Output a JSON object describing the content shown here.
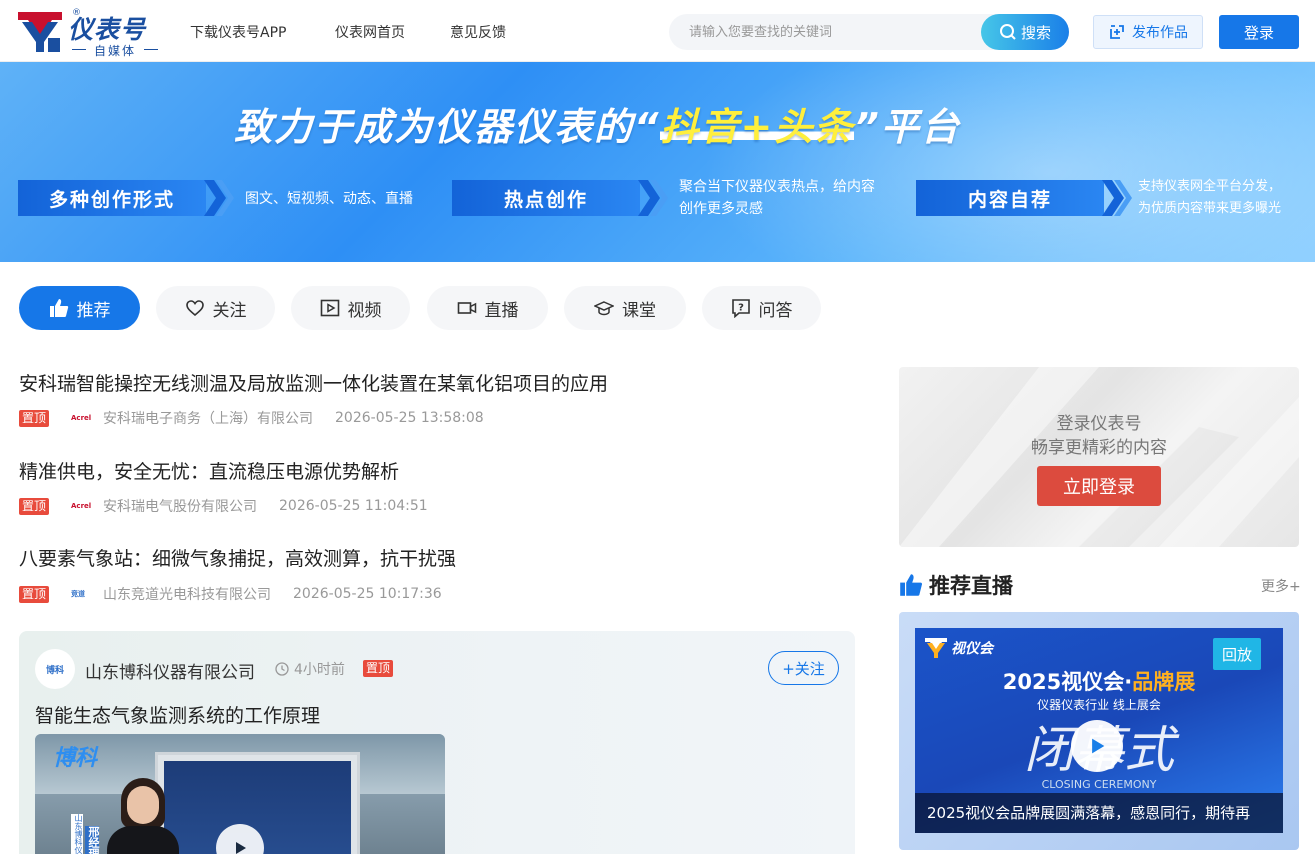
{
  "header": {
    "logo_title": "仪表号",
    "logo_sub": "自媒体",
    "logo_reg": "®",
    "nav": [
      "下载仪表号APP",
      "仪表网首页",
      "意见反馈"
    ],
    "search_placeholder": "请输入您要查找的关键词",
    "search_label": "搜索",
    "publish_label": "发布作品",
    "login_label": "登录"
  },
  "banner": {
    "title_pre": "致力于成为仪器仪表的“",
    "title_hl": "抖音+头条",
    "title_post": "”平台",
    "chips": [
      {
        "label": "多种创作形式",
        "desc": "图文、短视频、动态、直播"
      },
      {
        "label": "热点创作",
        "desc_1": "聚合当下仪器仪表热点，给内容",
        "desc_2": "创作更多灵感"
      },
      {
        "label": "内容自荐",
        "desc_1": "支持仪表网全平台分发，",
        "desc_2": "为优质内容带来更多曝光"
      }
    ]
  },
  "tabs": [
    {
      "label": "推荐",
      "icon": "thumbs-up-icon",
      "active": true
    },
    {
      "label": "关注",
      "icon": "heart-icon"
    },
    {
      "label": "视频",
      "icon": "video-play-icon"
    },
    {
      "label": "直播",
      "icon": "camera-icon"
    },
    {
      "label": "课堂",
      "icon": "graduation-cap-icon"
    },
    {
      "label": "问答",
      "icon": "question-icon"
    }
  ],
  "articles": [
    {
      "title": "安科瑞智能操控无线测温及局放监测一体化装置在某氧化铝项目的应用",
      "pin": "置顶",
      "logo": "Acrel",
      "source": "安科瑞电子商务（上海）有限公司",
      "date": "2026-05-25 13:58:08"
    },
    {
      "title": "精准供电，安全无忧：直流稳压电源优势解析",
      "pin": "置顶",
      "logo": "Acrel",
      "source": "安科瑞电气股份有限公司",
      "date": "2026-05-25 11:04:51"
    },
    {
      "title": "八要素气象站：细微气象捕捉，高效测算，抗干扰强",
      "pin": "置顶",
      "logo": "竞道",
      "source": "山东竞道光电科技有限公司",
      "date": "2026-05-25 10:17:36"
    }
  ],
  "video_card": {
    "avatar": "博科",
    "name": "山东博科仪器有限公司",
    "time": "4小时前",
    "pin": "置顶",
    "follow": "+关注",
    "title": "智能生态气象监测系统的工作原理",
    "thumb_brand": "博科",
    "thumb_side": "山东博科仪",
    "thumb_tag": "邢经理"
  },
  "sidebar": {
    "login_line1": "登录仪表号",
    "login_line2": "畅享更精彩的内容",
    "login_now": "立即登录",
    "live_title": "推荐直播",
    "more": "更多+",
    "live": {
      "logo": "视仪会",
      "badge": "回放",
      "head_pre": "2025视仪会·",
      "head_hl": "品牌展",
      "sub": "仪器仪表行业 线上展会",
      "big": "闭幕式",
      "cc": "CLOSING CEREMONY",
      "caption": "2025视仪会品牌展圆满落幕，感恩同行，期待再"
    }
  },
  "colors": {
    "primary": "#1677e8",
    "pin": "#e84b3c",
    "login_now": "#dc4b3e"
  }
}
